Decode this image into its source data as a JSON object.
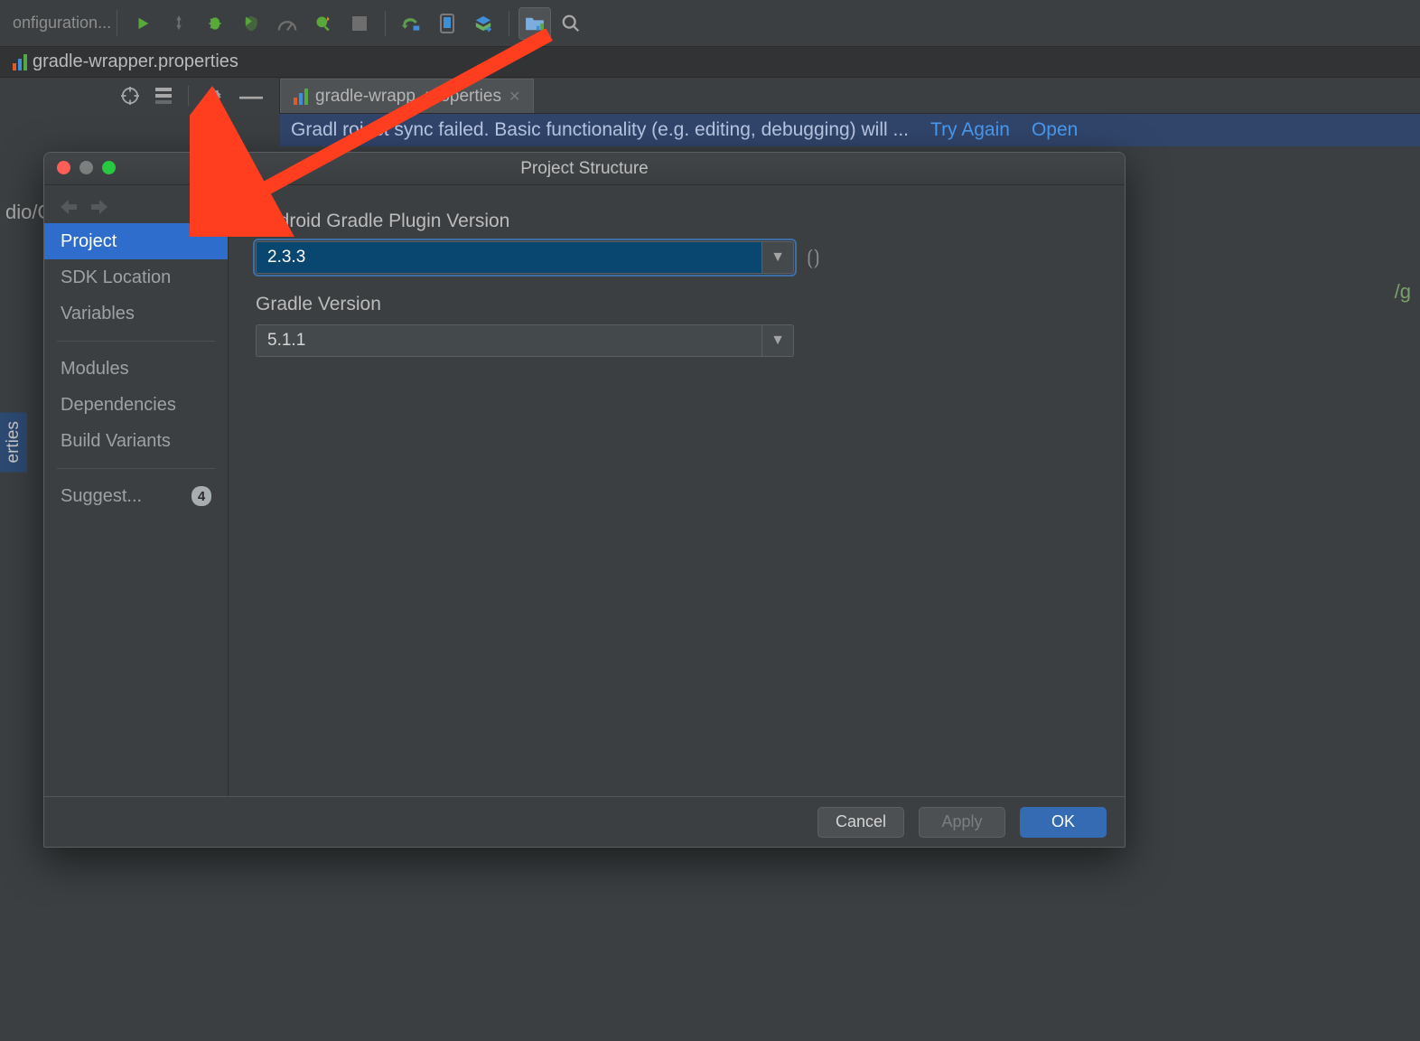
{
  "toolbar": {
    "config_label": "onfiguration..."
  },
  "file_tab": {
    "filename": "gradle-wrapper.properties"
  },
  "breadcrumb": {
    "text": "dio/OCRDemo"
  },
  "vertical_tab": {
    "label": "erties"
  },
  "editor": {
    "tab_label": "gradle-wrapp    .properties",
    "banner_msg": "Gradl    roject sync failed. Basic functionality (e.g. editing, debugging) will ...",
    "banner_link_try": "Try Again",
    "banner_link_open": "Open"
  },
  "right_gutter": "/g",
  "dialog": {
    "title": "Project Structure",
    "sidebar": {
      "items": [
        {
          "label": "Project"
        },
        {
          "label": "SDK Location"
        },
        {
          "label": "Variables"
        },
        {
          "label": "Modules"
        },
        {
          "label": "Dependencies"
        },
        {
          "label": "Build Variants"
        },
        {
          "label": "Suggest...",
          "badge": "4"
        }
      ]
    },
    "fields": {
      "plugin_label": "Android Gradle Plugin Version",
      "plugin_value": "2.3.3",
      "gradle_label": "Gradle Version",
      "gradle_value": "5.1.1"
    },
    "buttons": {
      "cancel": "Cancel",
      "apply": "Apply",
      "ok": "OK"
    }
  }
}
